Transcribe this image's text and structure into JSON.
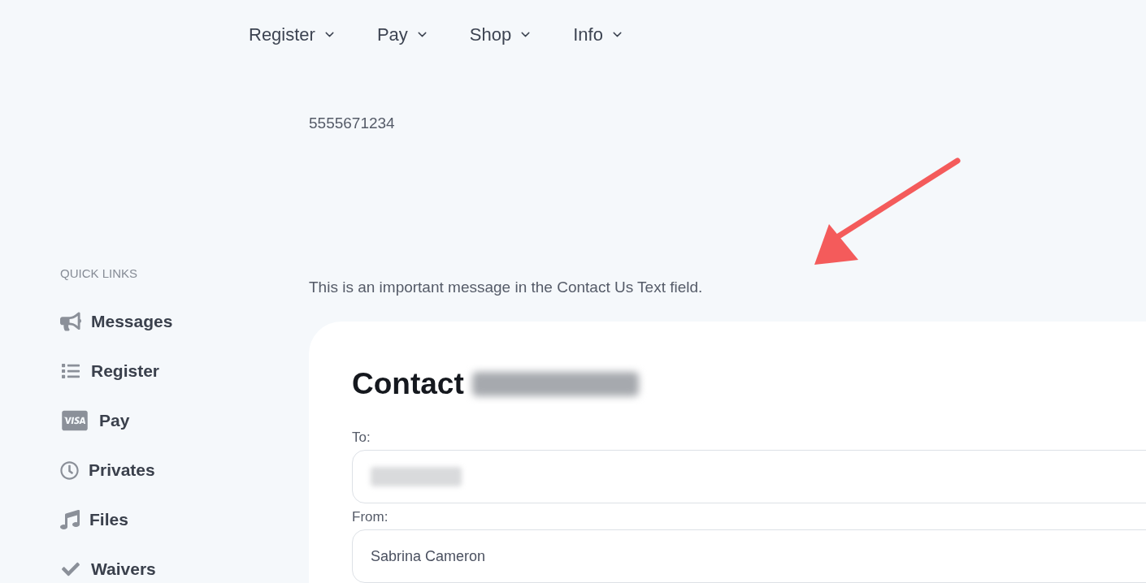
{
  "nav": [
    {
      "label": "Register"
    },
    {
      "label": "Pay"
    },
    {
      "label": "Shop"
    },
    {
      "label": "Info"
    }
  ],
  "phone": "5555671234",
  "message": "This is an important message in the Contact Us Text field.",
  "sidebar": {
    "heading": "QUICK LINKS",
    "items": [
      {
        "label": "Messages"
      },
      {
        "label": "Register"
      },
      {
        "label": "Pay"
      },
      {
        "label": "Privates"
      },
      {
        "label": "Files"
      },
      {
        "label": "Waivers"
      }
    ]
  },
  "contact_form": {
    "title": "Contact",
    "title_redacted": true,
    "fields": [
      {
        "label": "To:",
        "redacted": true
      },
      {
        "label": "From:",
        "value": "Sabrina Cameron",
        "redacted": false
      }
    ]
  }
}
